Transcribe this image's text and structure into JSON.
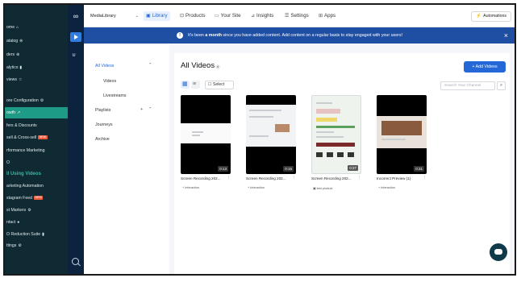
{
  "store_nav": {
    "items": [
      {
        "label": "ome",
        "icon": "home-icon",
        "glyph": "⌂"
      },
      {
        "label": "atalog",
        "icon": "catalog-icon",
        "glyph": "⊜"
      },
      {
        "label": "ders",
        "icon": "orders-icon",
        "glyph": "⊛"
      },
      {
        "label": "alytics",
        "icon": "analytics-icon",
        "glyph": "▮"
      },
      {
        "label": "views",
        "icon": "reviews-icon",
        "glyph": "☆"
      },
      {
        "label": "ore Configuration",
        "icon": "settings-icon",
        "glyph": "⚙"
      },
      {
        "label": "owth",
        "icon": "growth-icon",
        "glyph": "↗"
      },
      {
        "label": "fers & Discounts",
        "icon": "",
        "glyph": ""
      },
      {
        "label": "sell & Cross-sell",
        "badge": "NEW"
      },
      {
        "label": "rformance Marketing"
      },
      {
        "label": "O"
      },
      {
        "label": "ll Using Videos"
      },
      {
        "label": "arketing Automation"
      },
      {
        "label": "stagram Feed",
        "badge": "NEW"
      },
      {
        "label": "st Markers",
        "icon": "marker-icon",
        "glyph": "⚙"
      },
      {
        "label": "ntact",
        "icon": "chat-icon",
        "glyph": "●"
      },
      {
        "label": "O Reduction Suite",
        "icon": "suite-icon",
        "glyph": "▮"
      },
      {
        "label": "ttings",
        "icon": "settings-icon",
        "glyph": "⚙"
      }
    ]
  },
  "header": {
    "app_select": "MediaLibrary",
    "tabs": [
      {
        "label": "Library",
        "icon": "library-icon",
        "glyph": "▣"
      },
      {
        "label": "Products",
        "icon": "products-icon",
        "glyph": "⊡"
      },
      {
        "label": "Your Site",
        "icon": "site-icon",
        "glyph": "▭"
      },
      {
        "label": "Insights",
        "icon": "insights-icon",
        "glyph": "⊿"
      },
      {
        "label": "Settings",
        "icon": "settings-icon",
        "glyph": "☰"
      },
      {
        "label": "Apps",
        "icon": "apps-icon",
        "glyph": "⊞"
      }
    ],
    "automations": "Automations"
  },
  "banner": {
    "pre": "It's been ",
    "strong": "a month",
    "post": " since you have added content. Add content on a regular basis to stay engaged with your users!"
  },
  "subnav": {
    "all_videos": "All Videos",
    "videos": "Videos",
    "livestreams": "Livestreams",
    "playlists": "Playlists",
    "journeys": "Journeys",
    "archive": "Archive"
  },
  "main": {
    "title": "All Videos",
    "count": "4",
    "add_button": "+  Add Videos",
    "select": "Select",
    "search_placeholder": "Search Your Channel"
  },
  "videos": [
    {
      "name": "Screen Recording 202...",
      "duration": "0:13",
      "tag": "Interaction",
      "tag_prefix": "+"
    },
    {
      "name": "Screen Recording 202...",
      "duration": "0:15",
      "tag": "Interaction",
      "tag_prefix": "+"
    },
    {
      "name": "Screen Recording 202...",
      "duration": "0:27",
      "tag": "test product",
      "tag_prefix": "▣"
    },
    {
      "name": "Incorrect Preview (1)",
      "duration": "0:31",
      "tag": "Interaction",
      "tag_prefix": "+"
    }
  ],
  "colors": {
    "accent": "#2467d6",
    "banner": "#1f4fa3",
    "nav_bg": "#0f2a33",
    "nav_active": "#1e9b86"
  }
}
